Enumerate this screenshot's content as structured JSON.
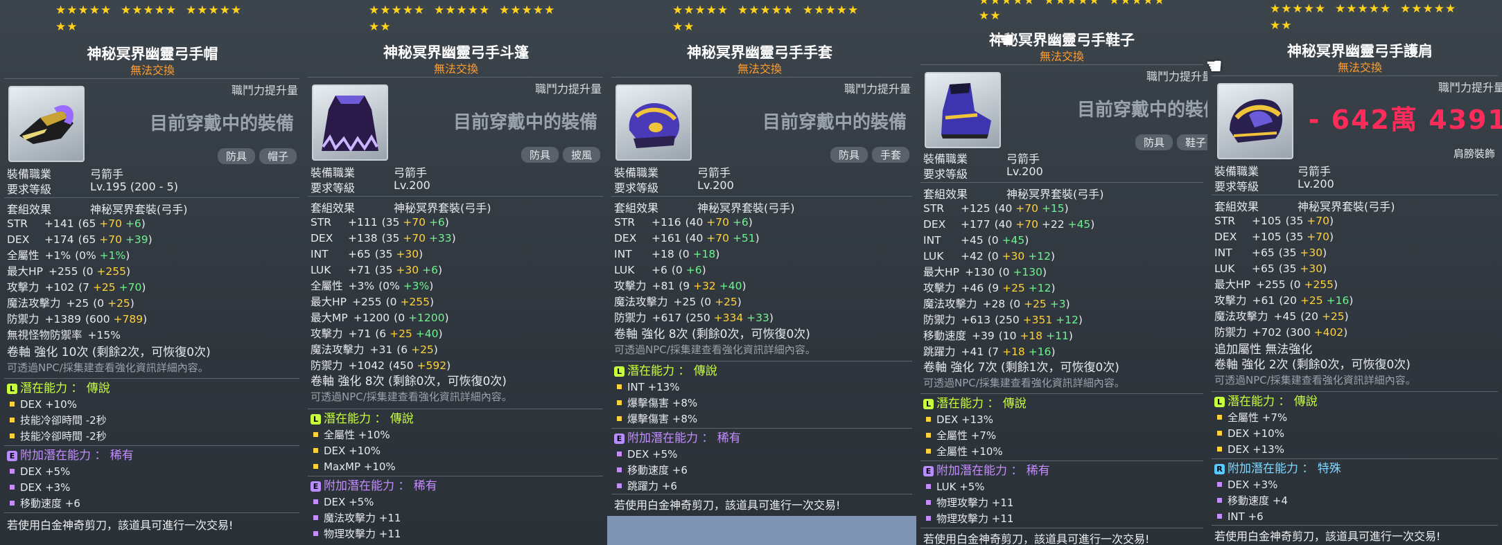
{
  "common": {
    "untradable": "無法交換",
    "cpl": "職鬥力提升量",
    "wearing": "目前穿戴中的裝備",
    "job_label": "裝備職業",
    "job_value": "弓箭手",
    "level_label": "要求等級",
    "set_label": "套組效果",
    "scissors": "若使用白金神奇剪刀，該道具可進行一次交易!",
    "npc_hint": "可透過NPC/採集建查看強化資訊詳細內容。",
    "potential": "潛在能力 ： 傳說",
    "bonus_potential_epic": "附加潛在能力 ： 稀有",
    "bonus_potential_rare": "附加潛在能力 ： 特殊",
    "stars_row1": "★★★★★  ★★★★★  ★★★★★",
    "stars_row2": "★★",
    "stars_row2_off": "★★★  ★★★★★  ★★★★★"
  },
  "panels": [
    {
      "title": "神秘冥界幽靈弓手帽",
      "tag1": "防具",
      "tag2": "帽子",
      "level": "Lv.195 (200 - 5)",
      "set": "神秘冥界套裝(弓手)",
      "stats": [
        [
          "STR",
          "+141",
          "(65 ",
          "+70",
          " ",
          "+6",
          ")"
        ],
        [
          "DEX",
          "+174",
          "(65 ",
          "+70",
          " ",
          "+39",
          ")"
        ],
        [
          "全屬性",
          "+1%",
          "(0% ",
          "",
          "",
          "+1%",
          ")"
        ],
        [
          "最大HP",
          "+255",
          "(0 ",
          "+255",
          "",
          "",
          ")"
        ],
        [
          "攻擊力",
          "+102",
          "(7 ",
          "+25",
          " ",
          "+70",
          ")"
        ],
        [
          "魔法攻擊力",
          "+25",
          "(0 ",
          "+25",
          "",
          "",
          ")"
        ],
        [
          "防禦力",
          "+1389",
          "(600 ",
          "+789",
          "",
          "",
          ")"
        ],
        [
          "無視怪物防禦率",
          "+15%",
          "",
          "",
          "",
          "",
          ""
        ]
      ],
      "scroll": "卷軸 強化 10次 (剩餘2次，可恢復0次)",
      "pot": [
        "DEX +10%",
        "技能冷卻時間 -2秒",
        "技能冷卻時間 -2秒"
      ],
      "bpot": [
        "DEX +5%",
        "DEX +3%",
        "移動速度 +6"
      ]
    },
    {
      "title": "神秘冥界幽靈弓手斗篷",
      "tag1": "防具",
      "tag2": "披風",
      "level": "Lv.200",
      "set": "神秘冥界套裝(弓手)",
      "stats": [
        [
          "STR",
          "+111",
          "(35 ",
          "+70",
          " ",
          "+6",
          ")"
        ],
        [
          "DEX",
          "+138",
          "(35 ",
          "+70",
          " ",
          "+33",
          ")"
        ],
        [
          "INT",
          "+65",
          "(35 ",
          "+30",
          "",
          "",
          ")"
        ],
        [
          "LUK",
          "+71",
          "(35 ",
          "+30",
          " ",
          "+6",
          ")"
        ],
        [
          "全屬性",
          "+3%",
          "(0% ",
          "",
          "",
          "+3%",
          ")"
        ],
        [
          "最大HP",
          "+255",
          "(0 ",
          "+255",
          "",
          "",
          ")"
        ],
        [
          "最大MP",
          "+1200",
          "(0 ",
          "",
          "",
          "+1200",
          ")"
        ],
        [
          "攻擊力",
          "+71",
          "(6 ",
          "+25",
          " ",
          "+40",
          ")"
        ],
        [
          "魔法攻擊力",
          "+31",
          "(6 ",
          "+25",
          "",
          "",
          ")"
        ],
        [
          "防禦力",
          "+1042",
          "(450 ",
          "+592",
          "",
          "",
          ")"
        ]
      ],
      "scroll": "卷軸 強化 8次 (剩餘0次，可恢復0次)",
      "pot": [
        "全屬性 +10%",
        "DEX +10%",
        "MaxMP +10%"
      ],
      "bpot": [
        "DEX +5%",
        "魔法攻擊力 +11",
        "物理攻擊力 +11"
      ]
    },
    {
      "title": "神秘冥界幽靈弓手手套",
      "tag1": "防具",
      "tag2": "手套",
      "level": "Lv.200",
      "set": "神秘冥界套裝(弓手)",
      "stats": [
        [
          "STR",
          "+116",
          "(40 ",
          "+70",
          " ",
          "+6",
          ")"
        ],
        [
          "DEX",
          "+161",
          "(40 ",
          "+70",
          " ",
          "+51",
          ")"
        ],
        [
          "INT",
          "+18",
          "(0 ",
          "",
          "",
          "+18",
          ")"
        ],
        [
          "LUK",
          "+6",
          "(0 ",
          "",
          "",
          "+6",
          ")"
        ],
        [
          "攻擊力",
          "+81",
          "(9 ",
          "+32",
          " ",
          "+40",
          ")"
        ],
        [
          "魔法攻擊力",
          "+25",
          "(0 ",
          "+25",
          "",
          "",
          ")"
        ],
        [
          "防禦力",
          "+617",
          "(250 ",
          "+334",
          " ",
          "+33",
          ")"
        ]
      ],
      "scroll": "卷軸 強化 8次 (剩餘0次，可恢復0次)",
      "pot": [
        "INT +13%",
        "爆擊傷害 +8%",
        "爆擊傷害 +8%"
      ],
      "bpot": [
        "DEX +5%",
        "移動速度 +6",
        "跳躍力 +6"
      ]
    },
    {
      "title": "神秘冥界幽靈弓手鞋子",
      "tag1": "防具",
      "tag2": "鞋子",
      "level": "Lv.200",
      "set": "神秘冥界套裝(弓手)",
      "stats": [
        [
          "STR",
          "+125",
          "(40 ",
          "+70",
          " ",
          "+15",
          ")"
        ],
        [
          "DEX",
          "+177",
          "(40 ",
          "+70",
          " +22 ",
          "+45",
          ")"
        ],
        [
          "INT",
          "+45",
          "(0 ",
          "",
          "",
          "+45",
          ")"
        ],
        [
          "LUK",
          "+42",
          "(0 ",
          "+30",
          " ",
          "+12",
          ")"
        ],
        [
          "最大HP",
          "+130",
          "(0 ",
          "",
          "",
          "+130",
          ")"
        ],
        [
          "攻擊力",
          "+46",
          "(9 ",
          "+25",
          " ",
          "+12",
          ")"
        ],
        [
          "魔法攻擊力",
          "+28",
          "(0 ",
          "+25",
          " ",
          "+3",
          ")"
        ],
        [
          "防禦力",
          "+613",
          "(250 ",
          "+351",
          " ",
          "+12",
          ")"
        ],
        [
          "移動速度",
          "+39",
          "(10 ",
          "+18",
          " ",
          "+11",
          ")"
        ],
        [
          "跳躍力",
          "+41",
          "(7 ",
          "+18",
          " ",
          "+16",
          ")"
        ]
      ],
      "scroll": "卷軸 強化 7次 (剩餘1次，可恢復0次)",
      "pot": [
        "DEX +13%",
        "全屬性 +7%",
        "全屬性 +10%"
      ],
      "bpot": [
        "LUK +5%",
        "物理攻擊力 +11",
        "物理攻擊力 +11"
      ]
    },
    {
      "title": "神秘冥界幽靈弓手護肩",
      "tag2": "肩膀裝飾",
      "damage": "- 642萬 4391",
      "level": "Lv.200",
      "set": "神秘冥界套裝(弓手)",
      "stats": [
        [
          "STR",
          "+105",
          "(35 ",
          "+70",
          "",
          "",
          ")"
        ],
        [
          "DEX",
          "+105",
          "(35 ",
          "+70",
          "",
          "",
          ")"
        ],
        [
          "INT",
          "+65",
          "(35 ",
          "+30",
          "",
          "",
          ")"
        ],
        [
          "LUK",
          "+65",
          "(35 ",
          "+30",
          "",
          "",
          ")"
        ],
        [
          "最大HP",
          "+255",
          "(0 ",
          "+255",
          "",
          "",
          ")"
        ],
        [
          "攻擊力",
          "+61",
          "(20 ",
          "+25",
          " ",
          "+16",
          ")"
        ],
        [
          "魔法攻擊力",
          "+45",
          "(20 ",
          "+25",
          "",
          "",
          ")"
        ],
        [
          "防禦力",
          "+702",
          "(300 ",
          "+402",
          "",
          "",
          ")"
        ]
      ],
      "extra": "追加屬性 無法強化",
      "scroll": "卷軸 強化 2次 (剩餘0次，可恢復0次)",
      "pot": [
        "全屬性 +7%",
        "DEX +10%",
        "DEX +13%"
      ],
      "bpot": [
        "DEX +3%",
        "移動速度 +4",
        "INT +6"
      ]
    }
  ]
}
